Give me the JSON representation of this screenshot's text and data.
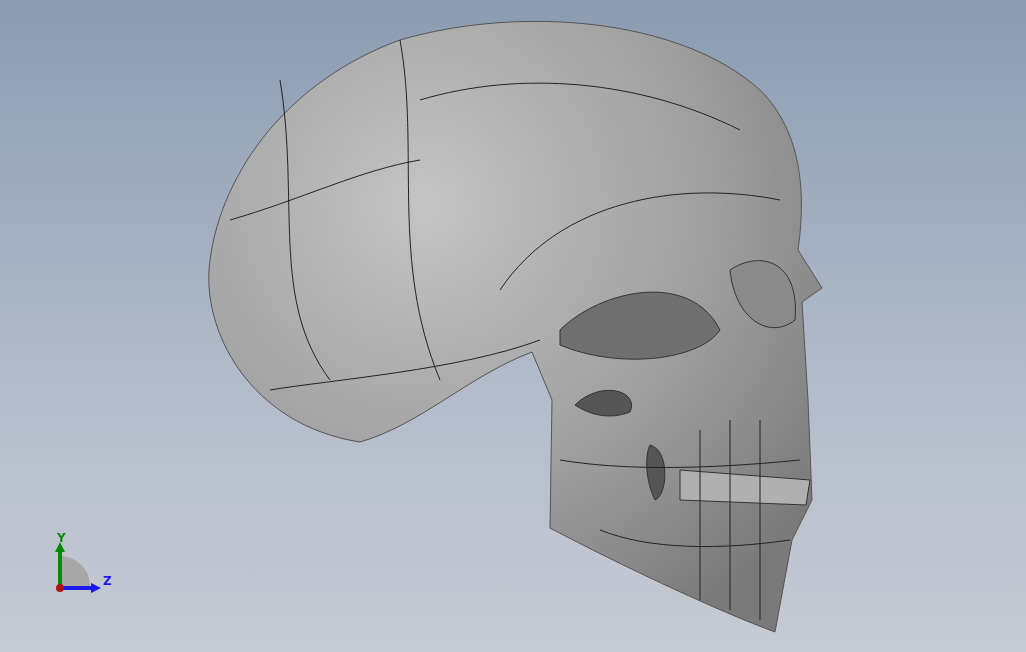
{
  "triad": {
    "axes": [
      {
        "kind": "y",
        "label": "Y",
        "color": "#0a8a0a"
      },
      {
        "kind": "z",
        "label": "Z",
        "color": "#1a1aee"
      }
    ]
  }
}
